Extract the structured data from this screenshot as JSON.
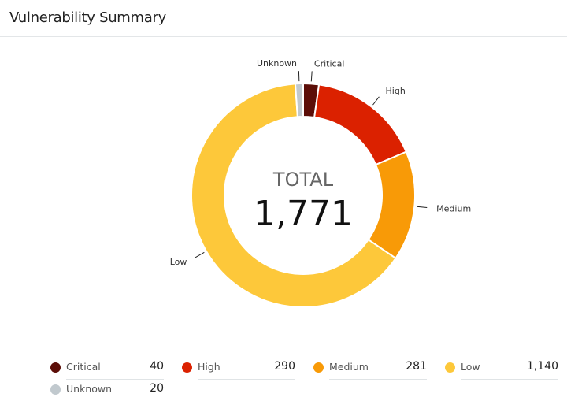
{
  "header": {
    "title": "Vulnerability Summary"
  },
  "center": {
    "label": "TOTAL",
    "value": "1,771"
  },
  "chart_data": {
    "type": "pie",
    "variant": "donut",
    "title": "Vulnerability Summary",
    "total": 1771,
    "categories": [
      "Critical",
      "High",
      "Medium",
      "Low",
      "Unknown"
    ],
    "values": [
      40,
      290,
      281,
      1140,
      20
    ],
    "colors": [
      "#5c0e08",
      "#db2100",
      "#f89a07",
      "#fdc83a",
      "#c1c9ce"
    ],
    "start": "top",
    "direction": "clockwise",
    "legend_position": "bottom"
  },
  "legend": [
    {
      "name": "Critical",
      "value": "40",
      "color": "#5c0e08"
    },
    {
      "name": "High",
      "value": "290",
      "color": "#db2100"
    },
    {
      "name": "Medium",
      "value": "281",
      "color": "#f89a07"
    },
    {
      "name": "Low",
      "value": "1,140",
      "color": "#fdc83a"
    },
    {
      "name": "Unknown",
      "value": "20",
      "color": "#c1c9ce"
    }
  ]
}
